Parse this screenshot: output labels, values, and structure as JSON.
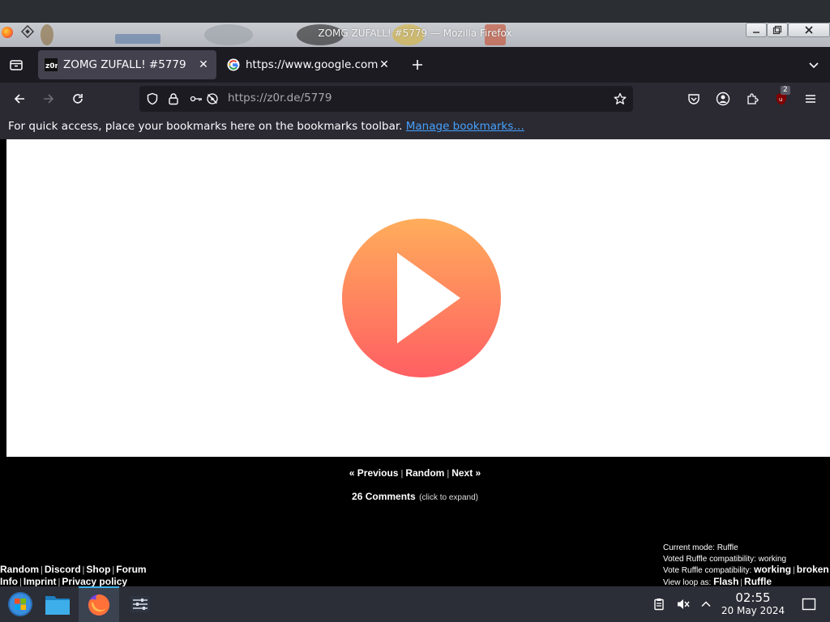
{
  "window": {
    "title": "ZOMG ZUFALL! #5779 — Mozilla Firefox"
  },
  "tabs": [
    {
      "label": "ZOMG ZUFALL! #5779",
      "favicon": "z0r-favicon-icon",
      "active": true
    },
    {
      "label": "https://www.google.com/",
      "favicon": "google-favicon-icon",
      "active": false
    }
  ],
  "navbar": {
    "url": "https://z0r.de/5779",
    "extensions_badge": "2"
  },
  "bookmarks": {
    "hint": "For quick access, place your bookmarks here on the bookmarks toolbar.",
    "manage_link": "Manage bookmarks…"
  },
  "page": {
    "nav": {
      "previous": "« Previous",
      "random": "Random",
      "next": "Next »"
    },
    "comments": {
      "label": "26 Comments",
      "hint": "(click to expand)"
    },
    "footer_left": {
      "row1": [
        "Random",
        "Discord",
        "Shop",
        "Forum"
      ],
      "row2": [
        "Info",
        "Imprint",
        "Privacy policy"
      ]
    },
    "footer_right": {
      "mode": "Current mode: Ruffle",
      "voted": "Voted Ruffle compatibility: working",
      "vote_label": "Vote Ruffle compatibility:",
      "vote_working": "working",
      "vote_broken": "broken",
      "loop_label": "View loop as:",
      "loop_flash": "Flash",
      "loop_ruffle": "Ruffle"
    }
  },
  "taskbar": {
    "time": "02:55",
    "date": "20 May 2024"
  },
  "colors": {
    "play_top": "#ffad5b",
    "play_bottom": "#ff5f63",
    "link": "#45a1ff",
    "taskbar_accent": "#3daee9"
  }
}
